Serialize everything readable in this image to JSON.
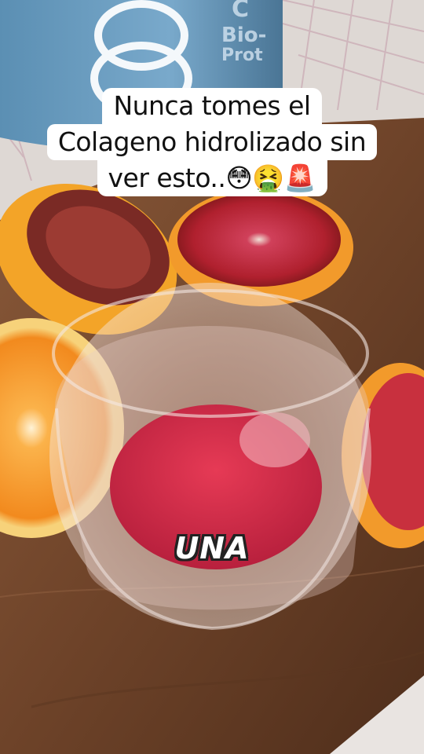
{
  "caption": {
    "line1": "Nunca tomes el",
    "line2": "Colageno hidrolizado sin",
    "line3": "ver esto..😳🤮🚨"
  },
  "subtitle": "UNA",
  "bottle": {
    "brand_fragment": "Bio-",
    "label_fragment": "Prot",
    "top_fragment": "C"
  }
}
